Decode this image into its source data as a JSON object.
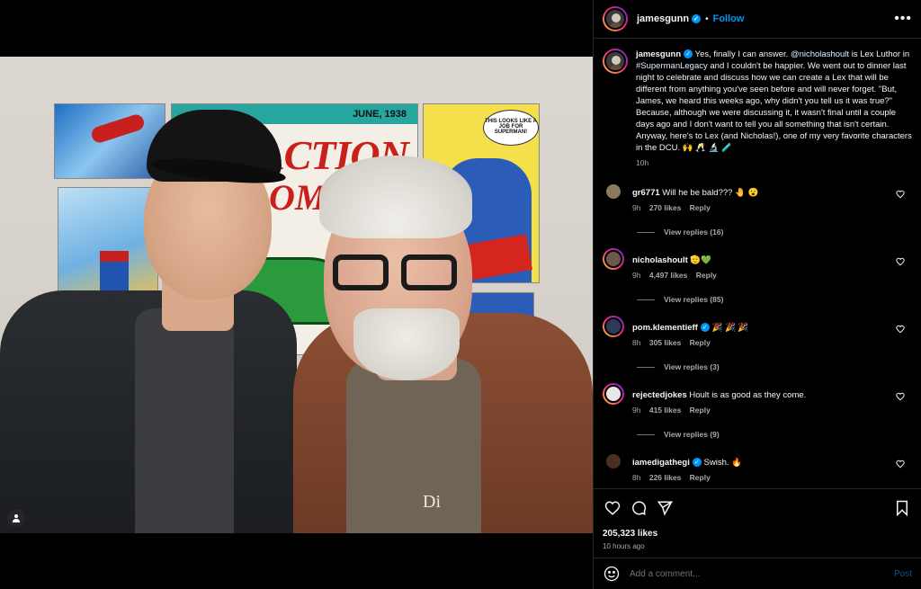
{
  "post": {
    "author": "jamesgunn",
    "follow_label": "Follow",
    "separator": "•",
    "more_label": "•••",
    "caption_parts": {
      "intro": "Yes, finally I can answer. ",
      "mention": "@nicholashoult",
      "mid": " is Lex Luthor in ",
      "hashtag": "#SupermanLegacy",
      "rest": " and I couldn't be happier. We went out to dinner last night to celebrate and discuss how we can create a Lex that will be different from anything you've seen before and will never forget. \"But, James, we heard this weeks ago, why didn't you tell us it was true?\" Because, although we were discussing it, it wasn't final until a couple days ago and I don't want to tell you all something that isn't certain. Anyway, here's to Lex (and Nicholas!), one of my very favorite characters in the DCU. 🙌 🥂 🔬 🧪"
    },
    "caption_time": "10h",
    "photo_text": {
      "poster_date": "JUNE, 1938",
      "poster_title_1": "ACTION",
      "poster_title_2": "OMI",
      "bubble": "THIS LOOKS LIKE A JOB FOR SUPERMAN!",
      "shirt_logo": "Di"
    }
  },
  "comments": [
    {
      "user": "gr6771",
      "verified": false,
      "text": "Will he be bald??? 🤚 😮",
      "time": "9h",
      "likes": "270 likes",
      "reply": "Reply",
      "replies": "View replies (16)",
      "av_color": "#8a7a5a",
      "ring": false
    },
    {
      "user": "nicholashoult",
      "verified": false,
      "text": "🫡💚",
      "time": "9h",
      "likes": "4,497 likes",
      "reply": "Reply",
      "replies": "View replies (85)",
      "av_color": "#6b5a4a",
      "ring": true
    },
    {
      "user": "pom.klementieff",
      "verified": true,
      "text": "🎉 🎉 🎉",
      "time": "8h",
      "likes": "305 likes",
      "reply": "Reply",
      "replies": "View replies (3)",
      "av_color": "#2e3a5a",
      "ring": true
    },
    {
      "user": "rejectedjokes",
      "verified": false,
      "text": "Hoult is as good as they come.",
      "time": "9h",
      "likes": "415 likes",
      "reply": "Reply",
      "replies": "View replies (9)",
      "av_color": "#e8e8e8",
      "ring": true
    },
    {
      "user": "iamedigathegi",
      "verified": true,
      "text": "Swish. 🔥",
      "time": "8h",
      "likes": "226 likes",
      "reply": "Reply",
      "replies": "",
      "av_color": "#4a3020",
      "ring": false
    }
  ],
  "actions": {
    "likes": "205,323 likes",
    "time_ago": "10 hours ago"
  },
  "composer": {
    "placeholder": "Add a comment...",
    "post_label": "Post"
  },
  "colors": {
    "accent": "#0095f6",
    "background": "#000000",
    "divider": "#262626"
  },
  "icons": [
    "like-icon",
    "comment-icon",
    "share-icon",
    "save-icon",
    "emoji-icon",
    "more-icon",
    "verified-icon",
    "user-tag-icon"
  ]
}
